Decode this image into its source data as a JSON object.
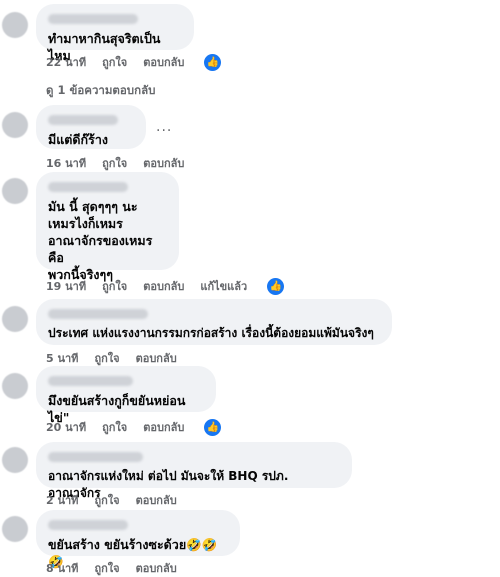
{
  "comments": [
    {
      "text": "ทำมาหากินสุจริตเป็นไหม",
      "time": "22 นาที",
      "like": "ถูกใจ",
      "reply": "ตอบกลับ",
      "edited": "",
      "has_like_badge": true
    },
    {
      "text": "มีแต่ดีก๊ร้าง",
      "time": "16 นาที",
      "like": "ถูกใจ",
      "reply": "ตอบกลับ",
      "edited": "",
      "has_like_badge": false
    },
    {
      "text": "มัน นี้ สุดๆๆๆ นะ\nเหมรไงก็เหมร\nอาณาจักรของเหมร คือ\nพวกนี้จริงๆๆ",
      "time": "19 นาที",
      "like": "ถูกใจ",
      "reply": "ตอบกลับ",
      "edited": "แก้ไขแล้ว",
      "has_like_badge": true
    },
    {
      "text": "ประเทศ แห่งแรงงานกรรมกรก่อสร้าง เรื่องนี้ต้องยอมแพ้มันจริงๆ",
      "time": "5 นาที",
      "like": "ถูกใจ",
      "reply": "ตอบกลับ",
      "edited": "",
      "has_like_badge": false
    },
    {
      "text": "มึงขยันสร้างกูก็ขยันหย่อนไข่\"",
      "time": "20 นาที",
      "like": "ถูกใจ",
      "reply": "ตอบกลับ",
      "edited": "",
      "has_like_badge": true
    },
    {
      "text": "อาณาจักรแห่งใหม่ ต่อไป มันจะให้ BHQ รปภ. อาณาจักร",
      "time": "2 นาที",
      "like": "ถูกใจ",
      "reply": "ตอบกลับ",
      "edited": "",
      "has_like_badge": false
    },
    {
      "text": "ขยันสร้าง ขยันร้างซะด้วย🤣🤣🤣",
      "time": "8 นาที",
      "like": "ถูกใจ",
      "reply": "ตอบกลับ",
      "edited": "",
      "has_like_badge": false
    }
  ],
  "view_replies": "ดู 1 ข้อความตอบกลับ",
  "more_options": "...",
  "icons": {
    "like_badge": "thumbs-up-icon"
  },
  "colors": {
    "bubble": "#f0f2f5",
    "meta": "#65676b",
    "like_blue": "#1877f2"
  }
}
